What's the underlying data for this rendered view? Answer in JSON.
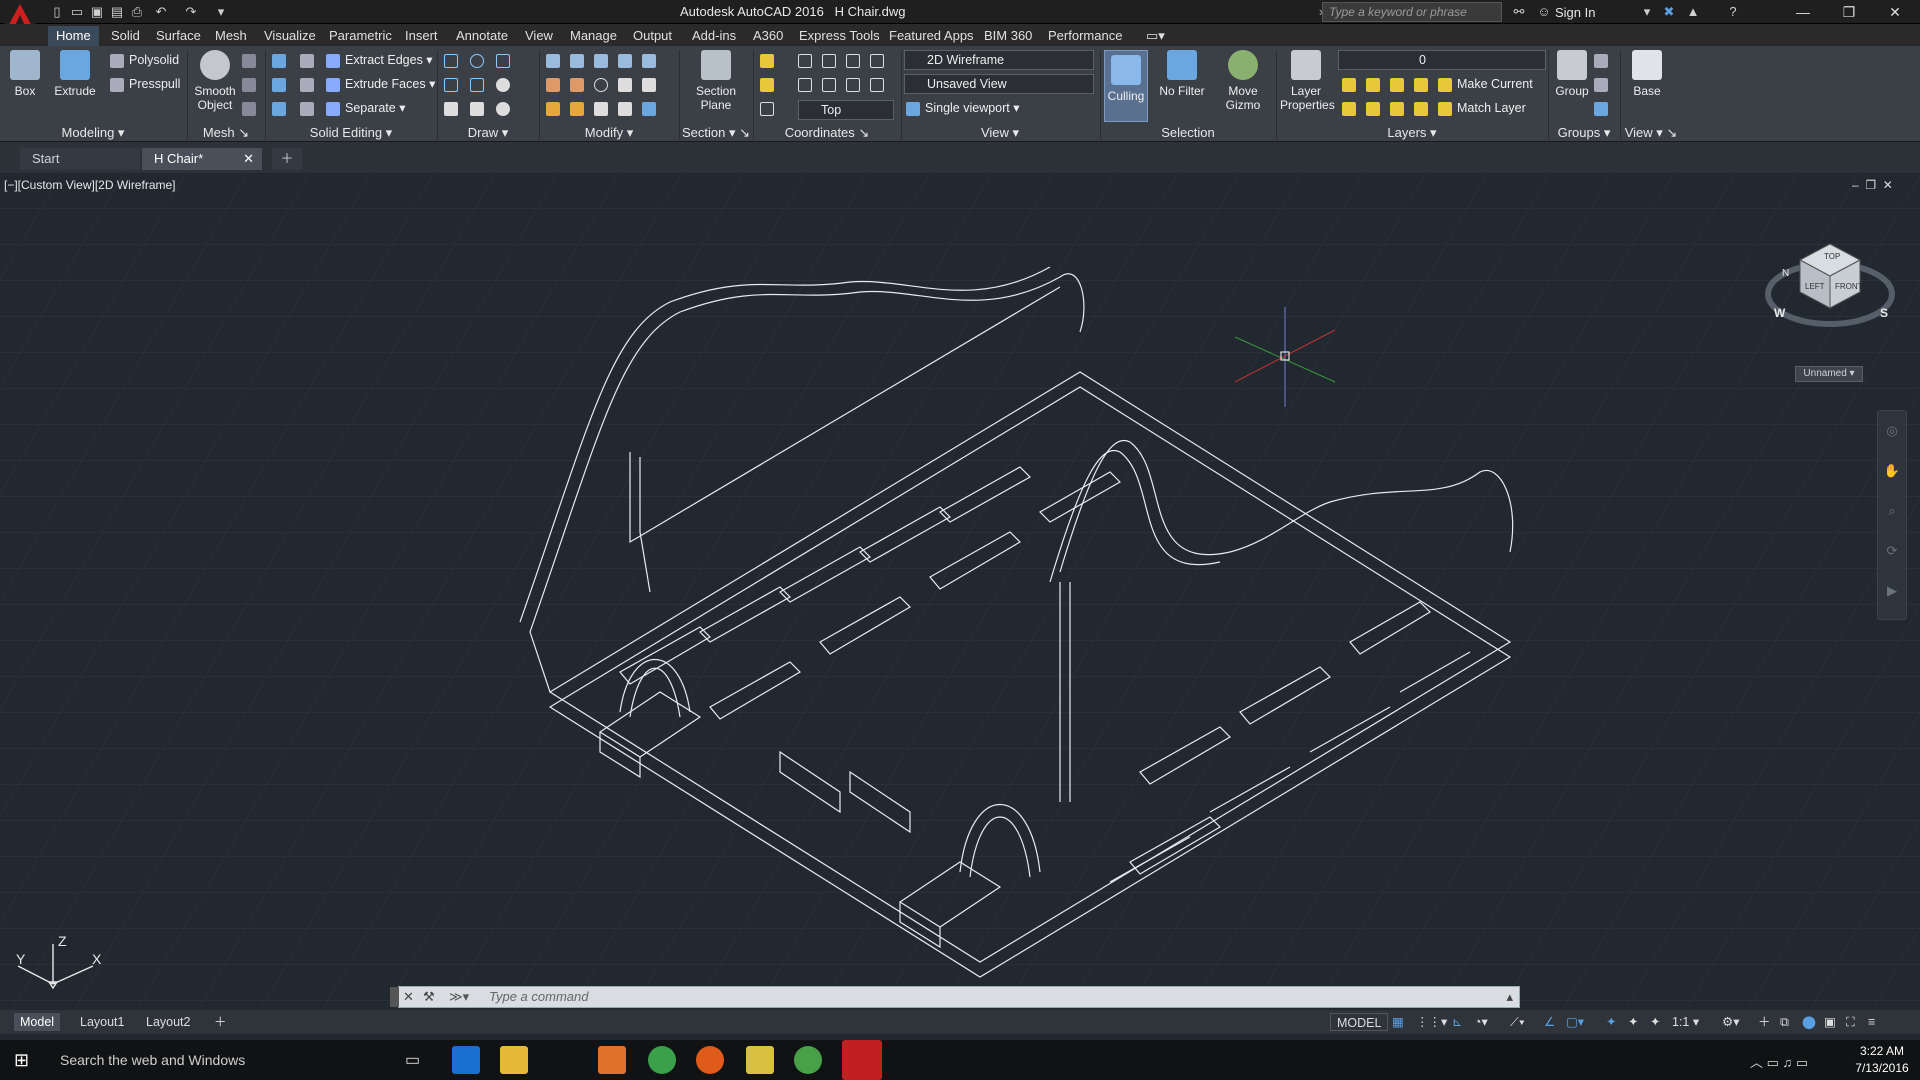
{
  "app": {
    "title": "Autodesk AutoCAD 2016",
    "file": "H Chair.dwg"
  },
  "titlebar": {
    "search_placeholder": "Type a keyword or phrase",
    "sign_in": "Sign In"
  },
  "ribbon_tabs": [
    "Home",
    "Solid",
    "Surface",
    "Mesh",
    "Visualize",
    "Parametric",
    "Insert",
    "Annotate",
    "View",
    "Manage",
    "Output",
    "Add-ins",
    "A360",
    "Express Tools",
    "Featured Apps",
    "BIM 360",
    "Performance"
  ],
  "active_tab": "Home",
  "ribbon": {
    "modeling": {
      "title": "Modeling",
      "box": "Box",
      "extrude": "Extrude",
      "polysolid": "Polysolid",
      "presspull": "Presspull"
    },
    "mesh": {
      "title": "Mesh",
      "smooth": "Smooth Object"
    },
    "solid_editing": {
      "title": "Solid Editing",
      "extract": "Extract Edges",
      "extrude_faces": "Extrude Faces",
      "separate": "Separate"
    },
    "draw": {
      "title": "Draw"
    },
    "modify": {
      "title": "Modify"
    },
    "section": {
      "title": "Section",
      "plane": "Section Plane"
    },
    "coordinates": {
      "title": "Coordinates",
      "ucs": "Top"
    },
    "view": {
      "title": "View",
      "visual_style": "2D Wireframe",
      "named_view": "Unsaved View",
      "viewport": "Single viewport"
    },
    "selection": {
      "title": "Selection",
      "culling": "Culling",
      "nofilter": "No Filter",
      "gizmo": "Move Gizmo"
    },
    "layers": {
      "title": "Layers",
      "layer_props": "Layer Properties",
      "current_layer": "0",
      "make_current": "Make Current",
      "match_layer": "Match Layer"
    },
    "groups": {
      "title": "Groups",
      "group": "Group"
    },
    "view2": {
      "title": "View",
      "base": "Base"
    }
  },
  "doc_tabs": [
    "Start",
    "H Chair*"
  ],
  "viewport": {
    "label": "[−][Custom View][2D Wireframe]",
    "wcs": "Unnamed",
    "cube_top": "TOP",
    "cube_left": "LEFT",
    "cube_front": "FRONT",
    "compass_w": "W",
    "compass_s": "S",
    "compass_n": "N"
  },
  "command": {
    "placeholder": "Type a command"
  },
  "layout_tabs": [
    "Model",
    "Layout1",
    "Layout2"
  ],
  "status": {
    "model": "MODEL",
    "scale": "1:1"
  },
  "taskbar": {
    "search": "Search the web and Windows",
    "time": "3:22 AM",
    "date": "7/13/2016"
  },
  "colors": {
    "accent": "#cc1f1f",
    "ribbon": "#3b3f46",
    "viewport": "#212830"
  }
}
